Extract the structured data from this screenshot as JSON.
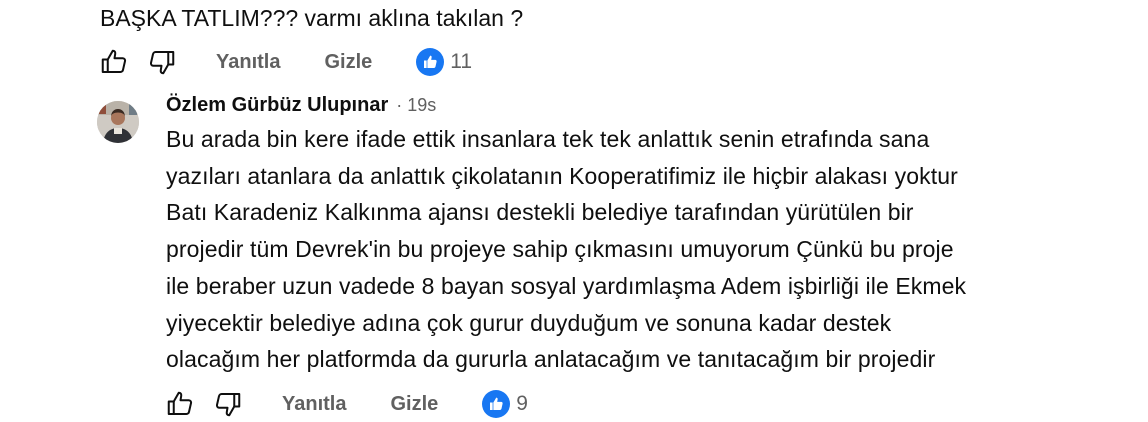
{
  "parent_comment": {
    "text_tail": "BAŞKA TATLIM??? varmı aklına takılan ?",
    "actions": {
      "reply_label": "Yanıtla",
      "hide_label": "Gizle",
      "reaction_count": "11"
    }
  },
  "reply": {
    "author": "Özlem Gürbüz Ulupınar",
    "separator": "·",
    "time": "19s",
    "body_lines": [
      "Bu arada bin kere ifade ettik insanlara tek tek anlattık senin etrafında sana",
      "yazıları atanlara da anlattık çikolatanın Kooperatifimiz ile hiçbir alakası yoktur",
      "Batı Karadeniz Kalkınma ajansı destekli belediye tarafından yürütülen bir",
      "projedir tüm Devrek'in bu projeye sahip çıkmasını umuyorum Çünkü bu proje",
      "ile beraber uzun vadede 8 bayan sosyal yardımlaşma Adem işbirliği ile Ekmek",
      "yiyecektir belediye adına çok gurur duyduğum ve sonuna kadar destek",
      "olacağım her platformda da gururla anlatacağım ve tanıtacağım bir projedir"
    ],
    "actions": {
      "reply_label": "Yanıtla",
      "hide_label": "Gizle",
      "reaction_count": "9"
    }
  },
  "icons": {
    "like": "thumbs-up-outline-icon",
    "dislike": "thumbs-down-outline-icon",
    "reaction": "like-reaction-icon"
  },
  "colors": {
    "text": "#0f0f0f",
    "secondary_text": "#606060",
    "reaction_blue": "#1877f2"
  }
}
